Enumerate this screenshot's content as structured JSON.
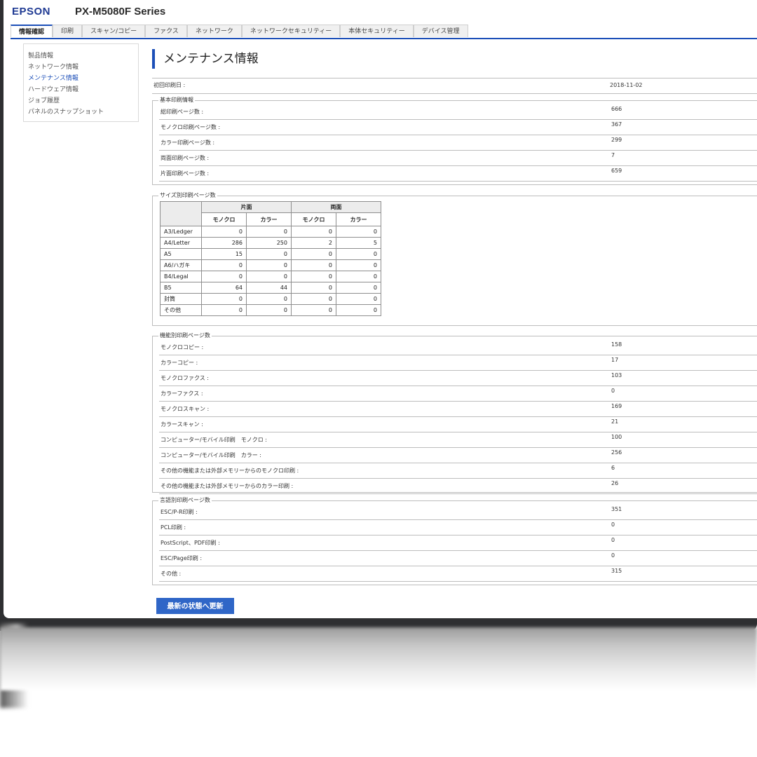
{
  "header": {
    "logo": "EPSON",
    "model": "PX-M5080F Series"
  },
  "tabs": [
    {
      "label": "情報確認",
      "active": true
    },
    {
      "label": "印刷"
    },
    {
      "label": "スキャン/コピー"
    },
    {
      "label": "ファクス"
    },
    {
      "label": "ネットワーク"
    },
    {
      "label": "ネットワークセキュリティー"
    },
    {
      "label": "本体セキュリティー"
    },
    {
      "label": "デバイス管理"
    }
  ],
  "sidebar": {
    "items": [
      {
        "label": "製品情報"
      },
      {
        "label": "ネットワーク情報"
      },
      {
        "label": "メンテナンス情報",
        "active": true
      },
      {
        "label": "ハードウェア情報"
      },
      {
        "label": "ジョブ履歴"
      },
      {
        "label": "パネルのスナップショット"
      }
    ]
  },
  "main": {
    "title": "メンテナンス情報",
    "first_print": {
      "label": "初回印刷日 :",
      "value": "2018-11-02"
    },
    "basic": {
      "legend": "基本印刷情報",
      "rows": [
        {
          "label": "総印刷ページ数 :",
          "value": "666"
        },
        {
          "label": "モノクロ印刷ページ数 :",
          "value": "367"
        },
        {
          "label": "カラー印刷ページ数 :",
          "value": "299"
        },
        {
          "label": "両面印刷ページ数 :",
          "value": "7"
        },
        {
          "label": "片面印刷ページ数 :",
          "value": "659"
        }
      ]
    },
    "size": {
      "legend": "サイズ別印刷ページ数",
      "group_single": "片面",
      "group_double": "両面",
      "mono": "モノクロ",
      "color": "カラー",
      "rows": [
        {
          "name": "A3/Ledger",
          "v": [
            "0",
            "0",
            "0",
            "0"
          ]
        },
        {
          "name": "A4/Letter",
          "v": [
            "286",
            "250",
            "2",
            "5"
          ]
        },
        {
          "name": "A5",
          "v": [
            "15",
            "0",
            "0",
            "0"
          ]
        },
        {
          "name": "A6/ハガキ",
          "v": [
            "0",
            "0",
            "0",
            "0"
          ]
        },
        {
          "name": "B4/Legal",
          "v": [
            "0",
            "0",
            "0",
            "0"
          ]
        },
        {
          "name": "B5",
          "v": [
            "64",
            "44",
            "0",
            "0"
          ]
        },
        {
          "name": "封筒",
          "v": [
            "0",
            "0",
            "0",
            "0"
          ]
        },
        {
          "name": "その他",
          "v": [
            "0",
            "0",
            "0",
            "0"
          ]
        }
      ]
    },
    "function": {
      "legend": "機能別印刷ページ数",
      "rows": [
        {
          "label": "モノクロコピー :",
          "value": "158"
        },
        {
          "label": "カラーコピー :",
          "value": "17"
        },
        {
          "label": "モノクロファクス :",
          "value": "103"
        },
        {
          "label": "カラーファクス :",
          "value": "0"
        },
        {
          "label": "モノクロスキャン :",
          "value": "169"
        },
        {
          "label": "カラースキャン :",
          "value": "21"
        },
        {
          "label": "コンピューター/モバイル印刷　モノクロ :",
          "value": "100"
        },
        {
          "label": "コンピューター/モバイル印刷　カラー :",
          "value": "256"
        },
        {
          "label": "その他の機能または外部メモリーからのモノクロ印刷 :",
          "value": "6"
        },
        {
          "label": "その他の機能または外部メモリーからのカラー印刷 :",
          "value": "26"
        }
      ]
    },
    "language": {
      "legend": "言語別印刷ページ数",
      "rows": [
        {
          "label": "ESC/P-R印刷 :",
          "value": "351"
        },
        {
          "label": "PCL印刷 :",
          "value": "0"
        },
        {
          "label": "PostScript、PDF印刷 :",
          "value": "0"
        },
        {
          "label": "ESC/Page印刷 :",
          "value": "0"
        },
        {
          "label": "その他 :",
          "value": "315"
        }
      ]
    },
    "refresh_label": "最新の状態へ更新"
  },
  "colors": {
    "accent": "#1c4fb8",
    "button": "#2f66c7",
    "bezel": "#2e2f31"
  }
}
